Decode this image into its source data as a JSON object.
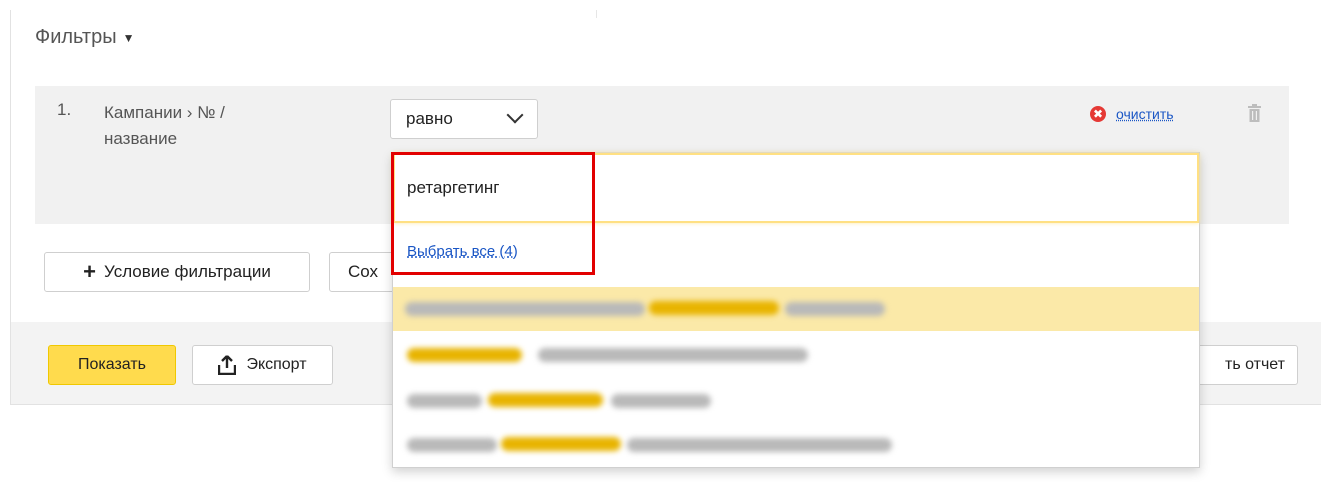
{
  "filters": {
    "title": "Фильтры",
    "caret": "▼"
  },
  "condition": {
    "number": "1.",
    "field_line1": "Кампании › № /",
    "field_line2": "название",
    "operator": "равно",
    "clear_label": "очистить",
    "clear_icon": "✖"
  },
  "buttons": {
    "add_condition_plus": "+",
    "add_condition": "Условие фильтрации",
    "save_partial": "Сох",
    "show": "Показать",
    "export": "Экспорт",
    "save_report_partial": "ть отчет"
  },
  "dropdown": {
    "search_value": "ретаргетинг",
    "select_all": "Выбрать все  (4)"
  },
  "colors": {
    "accent_yellow": "#ffdb4d",
    "link_blue": "#1a56c5",
    "highlight_row": "#fbe9a8",
    "annotation_red": "#e20000",
    "clear_red": "#e53935"
  },
  "icons": {
    "filters_caret": "caret-down-icon",
    "operator_chevron": "chevron-down-icon",
    "clear": "clear-circle-icon",
    "delete": "trash-icon",
    "add": "plus-icon",
    "export": "upload-icon"
  }
}
